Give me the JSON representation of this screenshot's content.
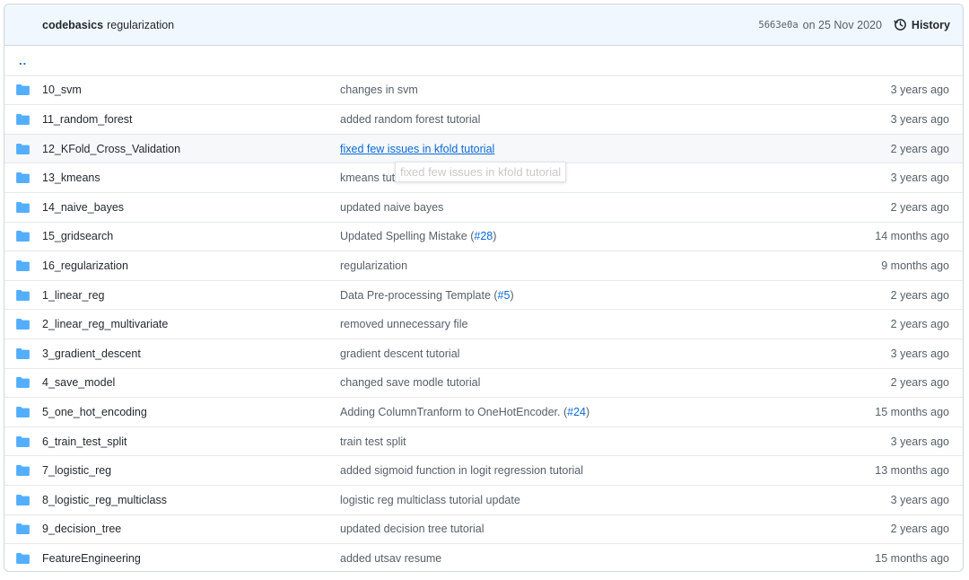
{
  "header": {
    "author": "codebasics",
    "message": "regularization",
    "sha": "5663e0a",
    "date": "on 25 Nov 2020",
    "history_label": "History"
  },
  "updir": "..",
  "rows": [
    {
      "name": "10_svm",
      "commit": "changes in svm",
      "age": "3 years ago"
    },
    {
      "name": "11_random_forest",
      "commit": "added random forest tutorial",
      "age": "3 years ago"
    },
    {
      "name": "12_KFold_Cross_Validation",
      "commit": "fixed few issues in kfold tutorial",
      "age": "2 years ago"
    },
    {
      "name": "13_kmeans",
      "commit": "kmeans tutorial",
      "age": "3 years ago"
    },
    {
      "name": "14_naive_bayes",
      "commit": "updated naive bayes",
      "age": "2 years ago"
    },
    {
      "name": "15_gridsearch",
      "commit": "Updated Spelling Mistake (",
      "commit_link": "#28",
      "commit_after": ")",
      "age": "14 months ago"
    },
    {
      "name": "16_regularization",
      "commit": "regularization",
      "age": "9 months ago"
    },
    {
      "name": "1_linear_reg",
      "commit": "Data Pre-processing Template (",
      "commit_link": "#5",
      "commit_after": ")",
      "age": "2 years ago"
    },
    {
      "name": "2_linear_reg_multivariate",
      "commit": "removed unnecessary file",
      "age": "2 years ago"
    },
    {
      "name": "3_gradient_descent",
      "commit": "gradient descent tutorial",
      "age": "3 years ago"
    },
    {
      "name": "4_save_model",
      "commit": "changed save modle tutorial",
      "age": "2 years ago"
    },
    {
      "name": "5_one_hot_encoding",
      "commit": "Adding ColumnTranform to OneHotEncoder. (",
      "commit_link": "#24",
      "commit_after": ")",
      "age": "15 months ago"
    },
    {
      "name": "6_train_test_split",
      "commit": "train test split",
      "age": "3 years ago"
    },
    {
      "name": "7_logistic_reg",
      "commit": "added sigmoid function in logit regression tutorial",
      "age": "13 months ago"
    },
    {
      "name": "8_logistic_reg_multiclass",
      "commit": "logistic reg multiclass tutorial update",
      "age": "3 years ago"
    },
    {
      "name": "9_decision_tree",
      "commit": "updated decision tree tutorial",
      "age": "2 years ago"
    },
    {
      "name": "FeatureEngineering",
      "commit": "added utsav resume",
      "age": "15 months ago"
    }
  ],
  "tooltip": "fixed few issues in kfold tutorial",
  "icons": {
    "folder": "folder-icon",
    "history": "history-icon"
  },
  "colors": {
    "folder": "#54aeff",
    "link": "#0969da",
    "header_bg": "#f1f7fe"
  }
}
